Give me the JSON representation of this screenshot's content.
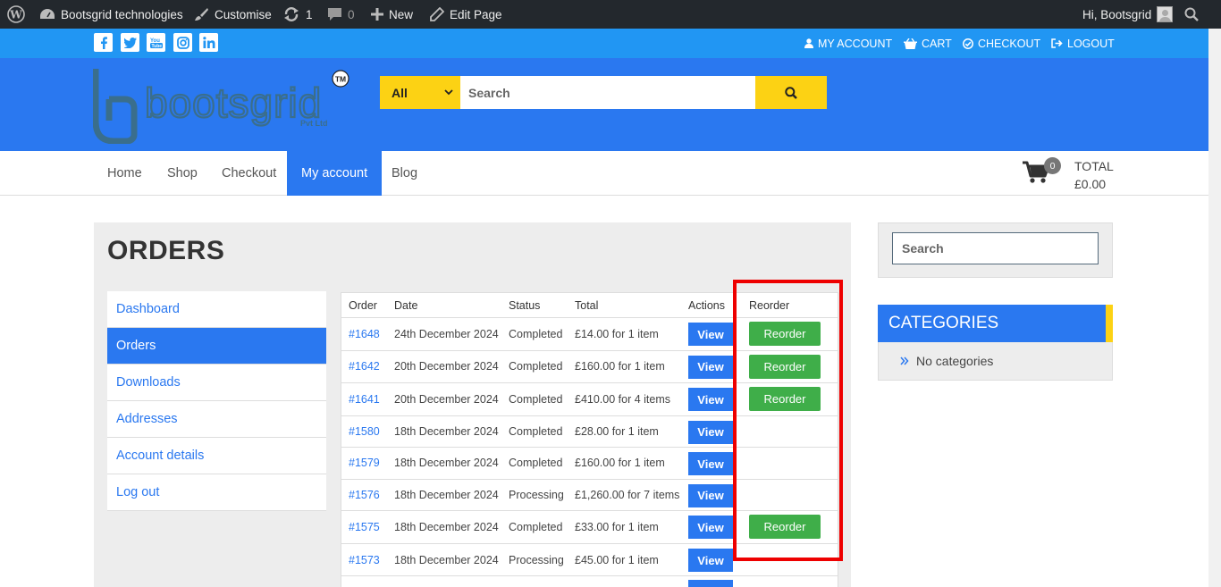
{
  "adminbar": {
    "site_name": "Bootsgrid technologies",
    "customise": "Customise",
    "updates_count": "1",
    "comments_count": "0",
    "new_label": "New",
    "edit_page": "Edit Page",
    "greeting": "Hi, Bootsgrid"
  },
  "topbar": {
    "social": [
      "f",
      "t",
      "yt",
      "ig",
      "in"
    ],
    "links": {
      "my_account": "MY ACCOUNT",
      "cart": "CART",
      "checkout": "CHECKOUT",
      "logout": "LOGOUT"
    }
  },
  "header": {
    "logo_text": "bootsgrid",
    "logo_sub": "Pvt Ltd",
    "logo_tm": "TM",
    "search": {
      "category": "All",
      "placeholder": "Search"
    }
  },
  "nav": {
    "items": [
      "Home",
      "Shop",
      "Checkout",
      "My account",
      "Blog"
    ],
    "active": "My account",
    "cart_count": "0",
    "total_label": "TOTAL",
    "total_value": "£0.00"
  },
  "page": {
    "title": "ORDERS"
  },
  "account_nav": [
    "Dashboard",
    "Orders",
    "Downloads",
    "Addresses",
    "Account details",
    "Log out"
  ],
  "orders": {
    "headers": {
      "order": "Order",
      "date": "Date",
      "status": "Status",
      "total": "Total",
      "actions": "Actions",
      "reorder": "Reorder"
    },
    "view_label": "View",
    "reorder_label": "Reorder",
    "rows": [
      {
        "order": "#1648",
        "date": "24th December 2024",
        "status": "Completed",
        "total": "£14.00 for 1 item",
        "reorder": true
      },
      {
        "order": "#1642",
        "date": "20th December 2024",
        "status": "Completed",
        "total": "£160.00 for 1 item",
        "reorder": true
      },
      {
        "order": "#1641",
        "date": "20th December 2024",
        "status": "Completed",
        "total": "£410.00 for 4 items",
        "reorder": true
      },
      {
        "order": "#1580",
        "date": "18th December 2024",
        "status": "Completed",
        "total": "£28.00 for 1 item",
        "reorder": false
      },
      {
        "order": "#1579",
        "date": "18th December 2024",
        "status": "Completed",
        "total": "£160.00 for 1 item",
        "reorder": false
      },
      {
        "order": "#1576",
        "date": "18th December 2024",
        "status": "Processing",
        "total": "£1,260.00 for 7 items",
        "reorder": false
      },
      {
        "order": "#1575",
        "date": "18th December 2024",
        "status": "Completed",
        "total": "£33.00 for 1 item",
        "reorder": true
      },
      {
        "order": "#1573",
        "date": "18th December 2024",
        "status": "Processing",
        "total": "£45.00 for 1 item",
        "reorder": false
      }
    ]
  },
  "sidebar": {
    "search_placeholder": "Search",
    "categories_title": "CATEGORIES",
    "no_categories": "No categories"
  },
  "colors": {
    "primary_blue": "#2a78f0",
    "strip_blue": "#2196f3",
    "accent_yellow": "#fcd214",
    "reorder_green": "#3fae49",
    "highlight_red": "#ee0000"
  }
}
